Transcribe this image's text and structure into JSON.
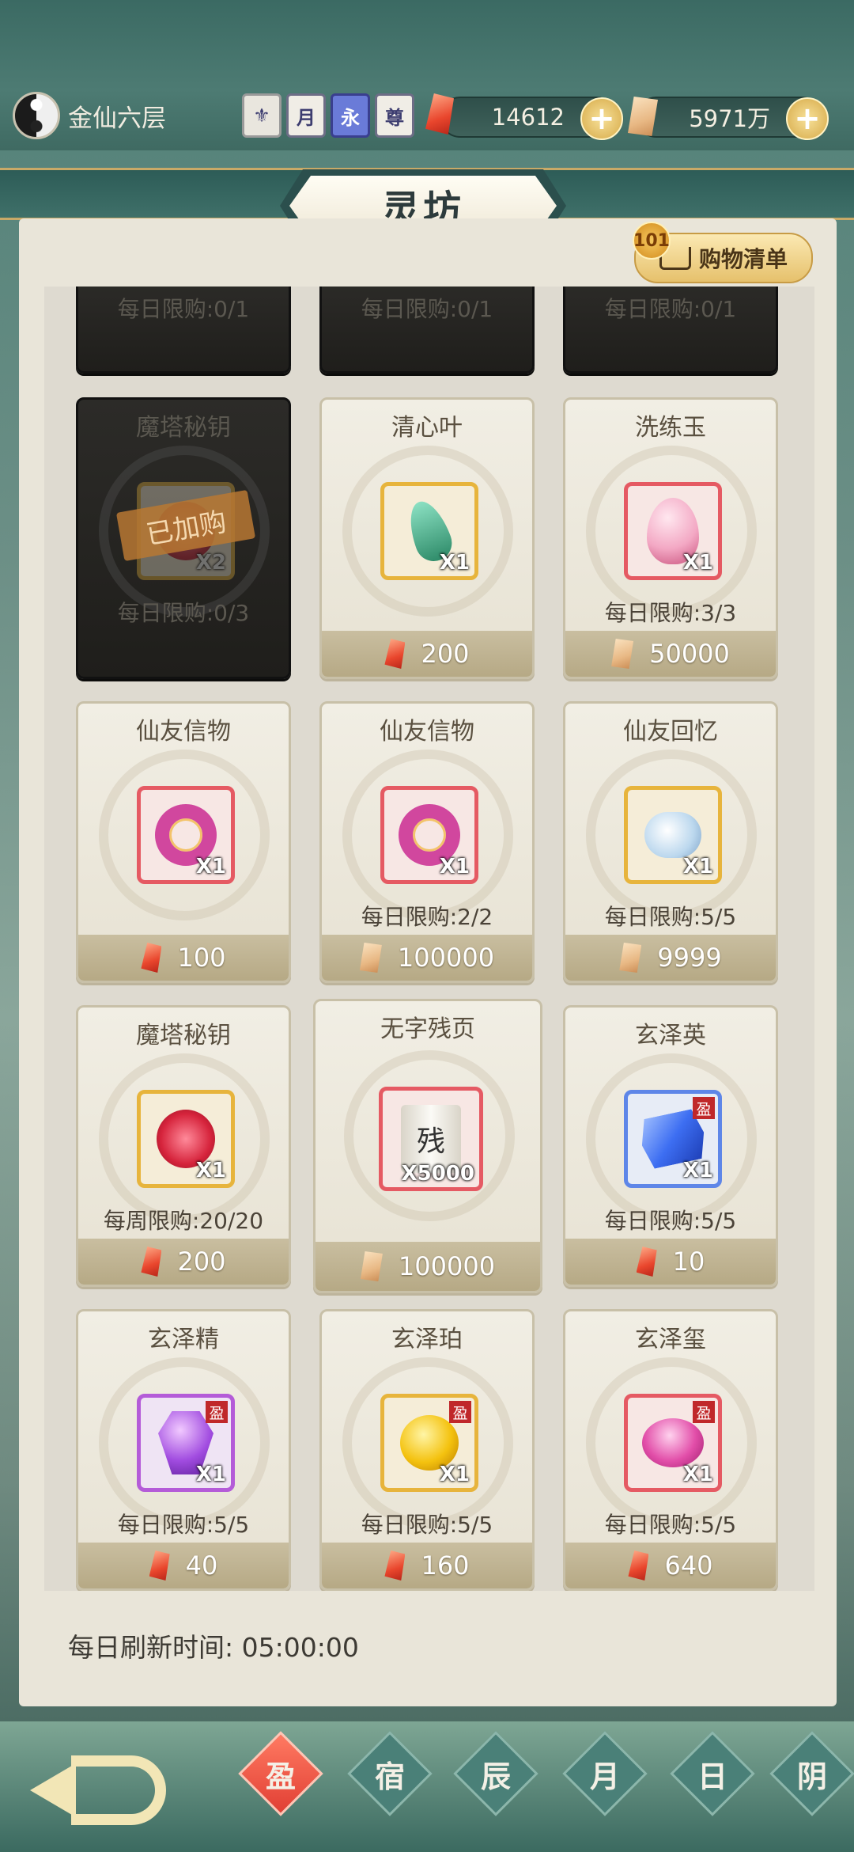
{
  "header": {
    "realm": "金仙六层",
    "title_badges": [
      "月",
      "永",
      "尊"
    ],
    "resources": [
      {
        "icon": "red-crystal-icon",
        "value": "14612"
      },
      {
        "icon": "scroll-paper-icon",
        "value": "5971万"
      }
    ],
    "page_title": "灵坊"
  },
  "cart": {
    "badge": "101",
    "label": "购物清单"
  },
  "top_partial_limits": [
    "每日限购:0/1",
    "每日限购:0/1",
    "每日限购:0/1"
  ],
  "items": [
    {
      "name": "魔塔秘钥",
      "qty": "X2",
      "limit": "每日限购:0/3",
      "stamp": "已加购",
      "sold": true
    },
    {
      "name": "清心叶",
      "qty": "X1",
      "limit": "",
      "price": "200",
      "currency": "red-crystal-icon"
    },
    {
      "name": "洗练玉",
      "qty": "X1",
      "limit": "每日限购:3/3",
      "price": "50000",
      "currency": "scroll-paper-icon"
    },
    {
      "name": "仙友信物",
      "qty": "X1",
      "limit": "",
      "price": "100",
      "currency": "red-crystal-icon"
    },
    {
      "name": "仙友信物",
      "qty": "X1",
      "limit": "每日限购:2/2",
      "price": "100000",
      "currency": "scroll-paper-icon"
    },
    {
      "name": "仙友回忆",
      "qty": "X1",
      "limit": "每日限购:5/5",
      "price": "9999",
      "currency": "scroll-paper-icon"
    },
    {
      "name": "魔塔秘钥",
      "qty": "X1",
      "limit": "每周限购:20/20",
      "price": "200",
      "currency": "red-crystal-icon"
    },
    {
      "name": "无字残页",
      "qty": "X5000",
      "limit": "",
      "price": "100000",
      "currency": "scroll-paper-icon",
      "scroll_char": "残"
    },
    {
      "name": "玄泽英",
      "qty": "X1",
      "limit": "每日限购:5/5",
      "price": "10",
      "currency": "red-crystal-icon",
      "tag": "盈"
    },
    {
      "name": "玄泽精",
      "qty": "X1",
      "limit": "每日限购:5/5",
      "price": "40",
      "currency": "red-crystal-icon",
      "tag": "盈"
    },
    {
      "name": "玄泽珀",
      "qty": "X1",
      "limit": "每日限购:5/5",
      "price": "160",
      "currency": "red-crystal-icon",
      "tag": "盈"
    },
    {
      "name": "玄泽玺",
      "qty": "X1",
      "limit": "每日限购:5/5",
      "price": "640",
      "currency": "red-crystal-icon",
      "tag": "盈"
    }
  ],
  "footer": {
    "refresh": "每日刷新时间: 05:00:00"
  },
  "bottom_nav": [
    "盈",
    "宿",
    "辰",
    "月",
    "日",
    "阴"
  ]
}
